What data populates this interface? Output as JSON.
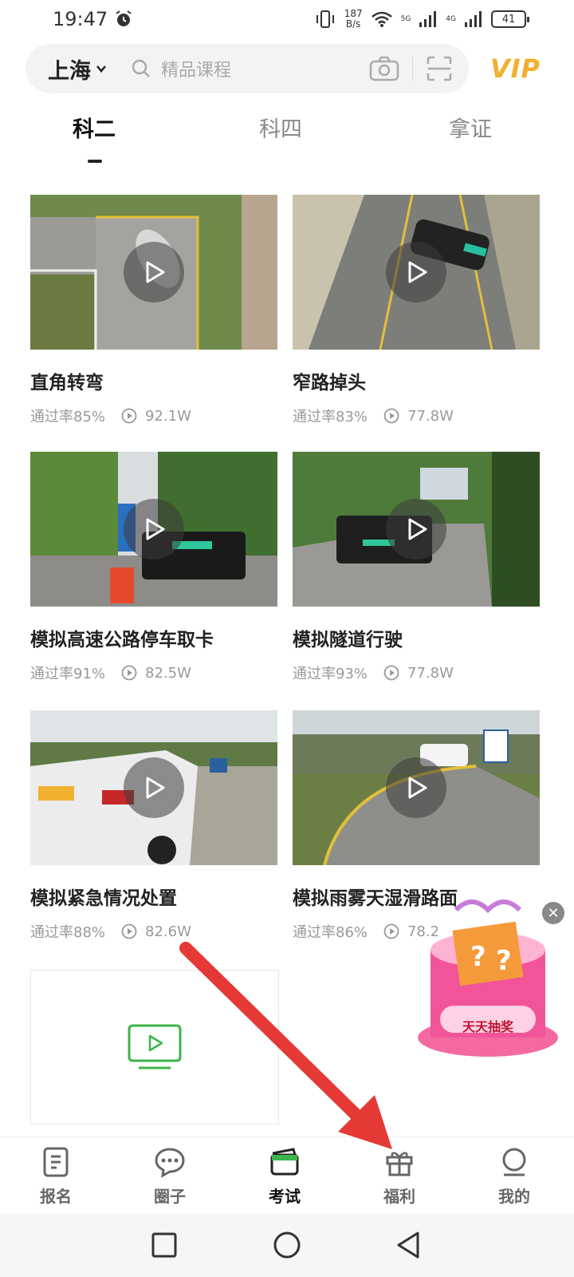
{
  "status_bar": {
    "time": "19:47",
    "net_speed_value": "187",
    "net_speed_unit": "B/s",
    "network_1": "5G",
    "network_2": "4G",
    "battery": "41"
  },
  "search": {
    "city": "上海",
    "placeholder": "精品课程",
    "vip_label": "VIP"
  },
  "tabs": [
    {
      "label": "科二",
      "active": true
    },
    {
      "label": "科四",
      "active": false
    },
    {
      "label": "拿证",
      "active": false
    }
  ],
  "cards": [
    {
      "title": "直角转弯",
      "pass_rate": "通过率85%",
      "views": "92.1W"
    },
    {
      "title": "窄路掉头",
      "pass_rate": "通过率83%",
      "views": "77.8W"
    },
    {
      "title": "模拟高速公路停车取卡",
      "pass_rate": "通过率91%",
      "views": "82.5W"
    },
    {
      "title": "模拟隧道行驶",
      "pass_rate": "通过率93%",
      "views": "77.8W"
    },
    {
      "title": "模拟紧急情况处置",
      "pass_rate": "通过率88%",
      "views": "82.6W"
    },
    {
      "title": "模拟雨雾天湿滑路面",
      "pass_rate": "通过率86%",
      "views": "78.2"
    }
  ],
  "lottery": {
    "label": "天天抽奖"
  },
  "bottom_nav": [
    {
      "label": "报名",
      "icon": "document-icon"
    },
    {
      "label": "圈子",
      "icon": "chat-icon"
    },
    {
      "label": "考试",
      "icon": "wallet-icon",
      "active": true
    },
    {
      "label": "福利",
      "icon": "gift-icon"
    },
    {
      "label": "我的",
      "icon": "profile-icon"
    }
  ],
  "colors": {
    "accent_green": "#3cb54a",
    "vip_gold": "#f0b030",
    "annotation_red": "#e53935"
  }
}
